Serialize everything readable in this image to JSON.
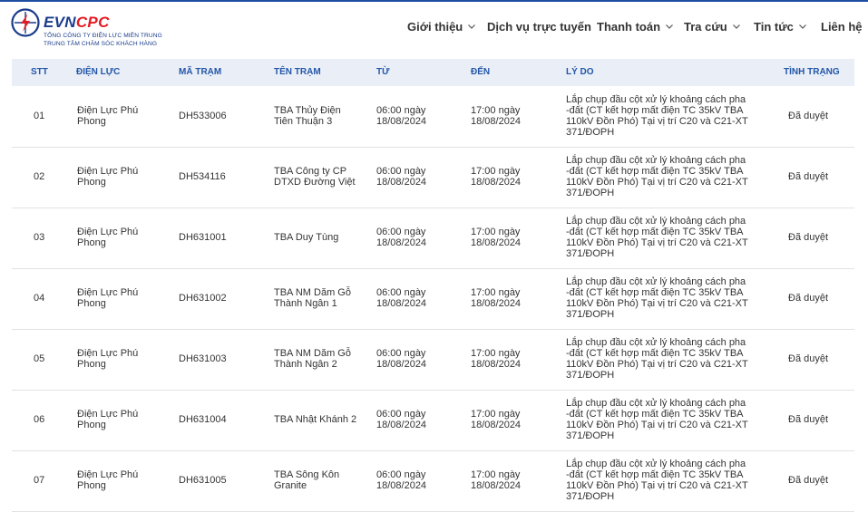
{
  "brand": {
    "evn": "EVN",
    "cpc": "CPC",
    "line1": "TỔNG CÔNG TY ĐIỆN LỰC MIỀN TRUNG",
    "line2": "TRUNG TÂM CHĂM SÓC KHÁCH HÀNG"
  },
  "nav": [
    "Giới thiệu",
    "Dịch vụ trực tuyến",
    "Thanh toán",
    "Tra cứu",
    "Tin tức",
    "Liên hệ"
  ],
  "nav_has_dropdown": [
    true,
    false,
    true,
    true,
    true,
    false
  ],
  "colors": {
    "brand_blue": "#1a3c8c",
    "brand_red": "#e31b23",
    "header_text": "#2356a8",
    "table_head_bg": "#e9eef7"
  },
  "table": {
    "headers": {
      "stt": "STT",
      "dien_luc": "ĐIỆN LỰC",
      "ma_tram": "MÃ TRẠM",
      "ten_tram": "TÊN TRẠM",
      "tu": "TỪ",
      "den": "ĐẾN",
      "ly_do": "LÝ DO",
      "tinh_trang": "TÌNH TRẠNG"
    },
    "rows": [
      {
        "stt": "01",
        "dien_luc": "Điện Lực Phú Phong",
        "ma_tram": "DH533006",
        "ten_tram": "TBA Thủy Điện Tiên Thuận 3",
        "tu": "06:00 ngày 18/08/2024",
        "den": "17:00 ngày 18/08/2024",
        "ly_do": "Lắp chụp đầu cột xử lý khoảng cách pha -đất (CT kết hợp mất điện TC 35kV TBA 110kV Đồn Phó) Tại vị trí C20 và C21-XT 371/ĐOPH",
        "tinh_trang": "Đã duyệt"
      },
      {
        "stt": "02",
        "dien_luc": "Điện Lực Phú Phong",
        "ma_tram": "DH534116",
        "ten_tram": "TBA Công ty CP DTXD Đường Việt",
        "tu": "06:00 ngày 18/08/2024",
        "den": "17:00 ngày 18/08/2024",
        "ly_do": "Lắp chụp đầu cột xử lý khoảng cách pha -đất (CT kết hợp mất điện TC 35kV TBA 110kV Đồn Phó) Tại vị trí C20 và C21-XT 371/ĐOPH",
        "tinh_trang": "Đã duyệt"
      },
      {
        "stt": "03",
        "dien_luc": "Điện Lực Phú Phong",
        "ma_tram": "DH631001",
        "ten_tram": "TBA Duy Tùng",
        "tu": "06:00 ngày 18/08/2024",
        "den": "17:00 ngày 18/08/2024",
        "ly_do": "Lắp chụp đầu cột xử lý khoảng cách pha -đất (CT kết hợp mất điện TC 35kV TBA 110kV Đồn Phó) Tại vị trí C20 và C21-XT 371/ĐOPH",
        "tinh_trang": "Đã duyệt"
      },
      {
        "stt": "04",
        "dien_luc": "Điện Lực Phú Phong",
        "ma_tram": "DH631002",
        "ten_tram": "TBA NM Dăm Gỗ Thành Ngân 1",
        "tu": "06:00 ngày 18/08/2024",
        "den": "17:00 ngày 18/08/2024",
        "ly_do": "Lắp chụp đầu cột xử lý khoảng cách pha -đất (CT kết hợp mất điện TC 35kV TBA 110kV Đồn Phó) Tại vị trí C20 và C21-XT 371/ĐOPH",
        "tinh_trang": "Đã duyệt"
      },
      {
        "stt": "05",
        "dien_luc": "Điện Lực Phú Phong",
        "ma_tram": "DH631003",
        "ten_tram": "TBA NM Dăm Gỗ Thành Ngân 2",
        "tu": "06:00 ngày 18/08/2024",
        "den": "17:00 ngày 18/08/2024",
        "ly_do": "Lắp chụp đầu cột xử lý khoảng cách pha -đất (CT kết hợp mất điện TC 35kV TBA 110kV Đồn Phó) Tại vị trí C20 và C21-XT 371/ĐOPH",
        "tinh_trang": "Đã duyệt"
      },
      {
        "stt": "06",
        "dien_luc": "Điện Lực Phú Phong",
        "ma_tram": "DH631004",
        "ten_tram": "TBA Nhật Khánh 2",
        "tu": "06:00 ngày 18/08/2024",
        "den": "17:00 ngày 18/08/2024",
        "ly_do": "Lắp chụp đầu cột xử lý khoảng cách pha -đất (CT kết hợp mất điện TC 35kV TBA 110kV Đồn Phó) Tại vị trí C20 và C21-XT 371/ĐOPH",
        "tinh_trang": "Đã duyệt"
      },
      {
        "stt": "07",
        "dien_luc": "Điện Lực Phú Phong",
        "ma_tram": "DH631005",
        "ten_tram": "TBA Sông Kôn Granite",
        "tu": "06:00 ngày 18/08/2024",
        "den": "17:00 ngày 18/08/2024",
        "ly_do": "Lắp chụp đầu cột xử lý khoảng cách pha -đất (CT kết hợp mất điện TC 35kV TBA 110kV Đồn Phó) Tại vị trí C20 và C21-XT 371/ĐOPH",
        "tinh_trang": "Đã duyệt"
      }
    ]
  }
}
